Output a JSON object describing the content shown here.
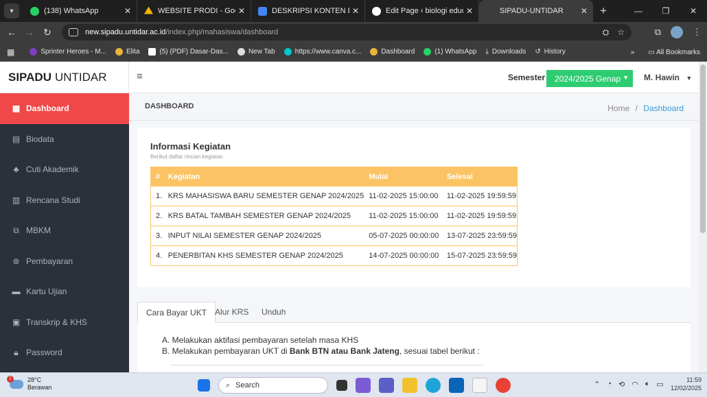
{
  "browser": {
    "tabs": [
      {
        "title": "(138) WhatsApp",
        "color": "#25d366",
        "active": false
      },
      {
        "title": "WEBSITE PRODI - Google Drive",
        "color": "#f4b400",
        "active": false
      },
      {
        "title": "DESKRIPSI KONTEN BAHASA",
        "color": "#4285f4",
        "active": false
      },
      {
        "title": "Edit Page ‹ biologi education",
        "color": "#ffffff",
        "active": false
      },
      {
        "title": "SIPADU-UNTIDAR",
        "color": "#3c3c3c",
        "active": true
      }
    ],
    "url_host": "new.sipadu.untidar.ac.id",
    "url_path": "/index.php/mahasiswa/dashboard",
    "bookmarks": [
      {
        "label": "Sprinter Heroes - M...",
        "color": "#7b3fbf"
      },
      {
        "label": "Elita",
        "color": "#e8b43a"
      },
      {
        "label": "(5) (PDF) Dasar-Das...",
        "color": "#ffffff"
      },
      {
        "label": "New Tab",
        "color": "#dddddd"
      },
      {
        "label": "https://www.canva.c...",
        "color": "#00c4cc"
      },
      {
        "label": "Dashboard",
        "color": "#e8b43a"
      },
      {
        "label": "(1) WhatsApp",
        "color": "#25d366"
      },
      {
        "label": "Downloads",
        "color": "#cccccc"
      },
      {
        "label": "History",
        "color": "#cccccc"
      }
    ],
    "all_bookmarks": "All Bookmarks"
  },
  "app": {
    "brand_bold": "SIPADU",
    "brand_rest": "UNTIDAR",
    "semester_label": "Semester",
    "semester_value": "2024/2025 Genap",
    "user": "M. Hawin",
    "accent": "#f04848",
    "semester_color": "#2ecc71"
  },
  "sidebar": [
    {
      "label": "Dashboard",
      "icon": "dashboard-icon",
      "active": true
    },
    {
      "label": "Biodata",
      "icon": "id-card-icon",
      "active": false
    },
    {
      "label": "Cuti Akademik",
      "icon": "users-icon",
      "active": false
    },
    {
      "label": "Rencana Studi",
      "icon": "book-icon",
      "active": false
    },
    {
      "label": "MBKM",
      "icon": "clone-icon",
      "active": false
    },
    {
      "label": "Pembayaran",
      "icon": "dollar-icon",
      "active": false
    },
    {
      "label": "Kartu Ujian",
      "icon": "card-icon",
      "active": false
    },
    {
      "label": "Transkrip & KHS",
      "icon": "transcript-icon",
      "active": false
    },
    {
      "label": "Password",
      "icon": "lock-icon",
      "active": false
    }
  ],
  "page": {
    "title": "DASHBOARD",
    "breadcrumb_home": "Home",
    "breadcrumb_sep": "/",
    "breadcrumb_current": "Dashboard"
  },
  "info": {
    "title": "Informasi Kegiatan",
    "subtitle": "Berikut daftar rincian kegiatan",
    "columns": [
      "#",
      "Kegiatan",
      "Mulai",
      "Selesai"
    ],
    "rows": [
      [
        "1.",
        "KRS MAHASISWA BARU SEMESTER GENAP 2024/2025",
        "11-02-2025 15:00:00",
        "11-02-2025 19:59:59"
      ],
      [
        "2.",
        "KRS BATAL TAMBAH SEMESTER GENAP 2024/2025",
        "11-02-2025 15:00:00",
        "11-02-2025 19:59:59"
      ],
      [
        "3.",
        "INPUT NILAI SEMESTER GENAP 2024/2025",
        "05-07-2025 00:00:00",
        "13-07-2025 23:59:59"
      ],
      [
        "4.",
        "PENERBITAN KHS SEMESTER GENAP 2024/2025",
        "14-07-2025 00:00:00",
        "15-07-2025 23:59:59"
      ]
    ]
  },
  "tabs": [
    "Cara Bayar UKT",
    "Alur KRS",
    "Unduh"
  ],
  "ukt": {
    "line1": "A. Melakukan aktifasi pembayaran setelah masa KHS",
    "line2_pre": "B. Melakukan pembayaran UKT di ",
    "line2_bold": "Bank BTN atau Bank Jateng",
    "line2_post": ", sesuai tabel berikut :"
  },
  "taskbar": {
    "temp": "28°C",
    "weather": "Berawan",
    "weather_badge": "1",
    "search": "Search",
    "time": "11:59",
    "date": "12/02/2025"
  }
}
